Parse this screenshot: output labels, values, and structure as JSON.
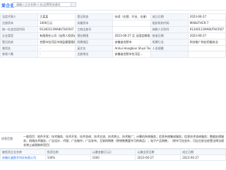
{
  "header": {
    "brand": "爱企查",
    "search_placeholder": "请输入企业名称/人名/品牌等关键词"
  },
  "company_name_top": "安徽红盒数字科技有限公司",
  "rows": [
    [
      "法定代表人",
      "王某某",
      "登记状态",
      "存续（在营、开业、在册）",
      "成立日期",
      "2023-06-27"
    ],
    [
      "注册资本",
      "1000万元",
      "实缴资本",
      "",
      "组织机构代码",
      "MA8UTHCR-7"
    ],
    [
      "统一社会信用代码",
      "91340111MA8UTHCR07",
      "工商注册号",
      "",
      "纳税人识别号",
      "91340111MA8UTHCR07"
    ],
    [
      "企业类型",
      "有限责任公司（自然人投资或控股）",
      "营业期限",
      "2023-06-27 至 无固定期限",
      "核准日期",
      "2023-06-27"
    ],
    [
      "登记机关",
      "合肥市包河区市场监督管理局",
      "所属地区",
      "安徽省合肥市",
      "所属行业",
      "科技推广和应用服务业"
    ],
    [
      "曾用名",
      "-",
      "英文名",
      "Anhui Hongbian Shuzi Technology Co., Ltd.",
      "人员规模",
      ""
    ],
    [
      "参保人数",
      "-",
      "注册地址",
      "安徽省合肥市包河区…",
      "",
      ""
    ]
  ],
  "scope": {
    "label": "经营范围",
    "text": "一般项目：软件开发；技术服务、技术开发、技术咨询、技术交流、技术转让、技术推广；计算机系统服务；信息系统集成服务；信息技术咨询服务；数据处理服务；网络技术服务；广告设计、代理；广告制作；广告发布；互联网销售（除销售需要许可的商品）；电子产品销售；（除许可业务外，可自主依法经营法律法规非禁止或限制的项目）"
  },
  "invest": {
    "headers": [
      "被投资企业名称",
      "投资比例",
      "认缴金额(万元)",
      "认缴出资日期",
      "成立日期"
    ],
    "row": [
      "安徽红盒数字科技有限公司",
      "100%",
      "1000",
      "2023-06-27",
      "2023-06-27"
    ]
  }
}
